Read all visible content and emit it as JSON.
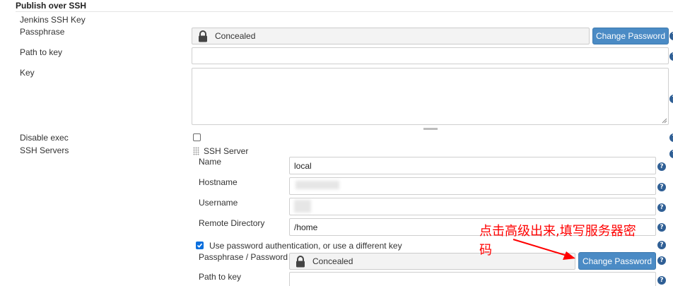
{
  "section": {
    "title": "Publish over SSH"
  },
  "jenkins_key": {
    "label_line1": "Jenkins SSH Key",
    "label_line2": "Passphrase",
    "value": "Concealed",
    "button": "Change Password"
  },
  "path_to_key": {
    "label": "Path to key",
    "value": ""
  },
  "key": {
    "label": "Key",
    "value": ""
  },
  "disable_exec": {
    "label": "Disable exec",
    "checked": false
  },
  "ssh_servers": {
    "label": "SSH Servers",
    "server_header": "SSH Server",
    "name": {
      "label": "Name",
      "value": "local"
    },
    "hostname": {
      "label": "Hostname",
      "value": ""
    },
    "username": {
      "label": "Username",
      "value": ""
    },
    "remote_directory": {
      "label": "Remote Directory",
      "value": "/home"
    },
    "use_password": {
      "label": "Use password authentication, or use a different key",
      "checked": true
    },
    "passphrase": {
      "label": "Passphrase / Password",
      "value": "Concealed",
      "button": "Change Password"
    },
    "path_to_key": {
      "label": "Path to key",
      "value": ""
    }
  },
  "annotation": {
    "line1": "点击高级出来,填写服务器密",
    "line2": "码",
    "color": "#ff0000"
  },
  "icons": {
    "help": "question-mark-icon",
    "lock": "lock-icon",
    "arrow": "arrow-icon",
    "handle": "drag-handle-icon"
  }
}
